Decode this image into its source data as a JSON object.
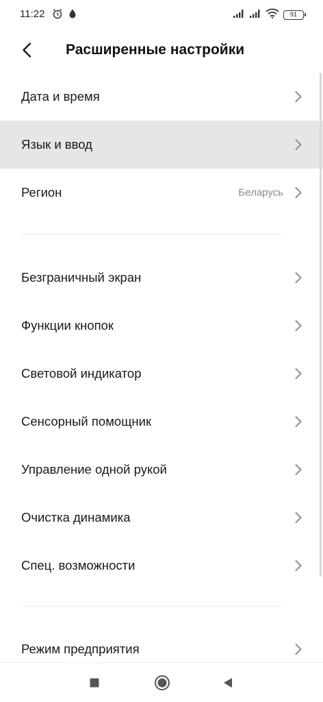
{
  "status_bar": {
    "time": "11:22",
    "battery": "91"
  },
  "header": {
    "title": "Расширенные настройки"
  },
  "rows": [
    {
      "label": "Дата и время",
      "value": ""
    },
    {
      "label": "Язык и ввод",
      "value": ""
    },
    {
      "label": "Регион",
      "value": "Беларусь"
    },
    {
      "label": "Безграничный экран",
      "value": ""
    },
    {
      "label": "Функции кнопок",
      "value": ""
    },
    {
      "label": "Световой индикатор",
      "value": ""
    },
    {
      "label": "Сенсорный помощник",
      "value": ""
    },
    {
      "label": "Управление одной рукой",
      "value": ""
    },
    {
      "label": "Очистка динамика",
      "value": ""
    },
    {
      "label": "Спец. возможности",
      "value": ""
    },
    {
      "label": "Режим предприятия",
      "value": ""
    }
  ],
  "colors": {
    "highlight": "#e6e6e6",
    "secondary_text": "#8a8a8a"
  }
}
